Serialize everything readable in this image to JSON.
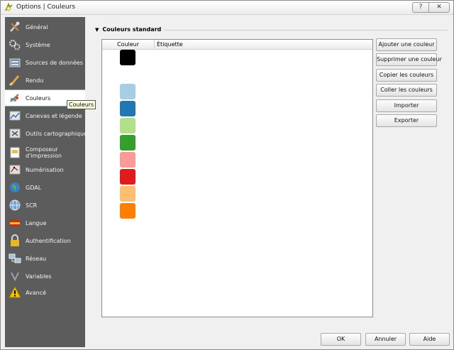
{
  "window": {
    "title": "Options | Couleurs"
  },
  "titlebar": {
    "help_label": "?",
    "close_label": "✕"
  },
  "sidebar": {
    "items": [
      {
        "label": "Général",
        "icon": "tools-icon"
      },
      {
        "label": "Système",
        "icon": "gears-icon"
      },
      {
        "label": "Sources de données",
        "icon": "datasource-icon"
      },
      {
        "label": "Rendu",
        "icon": "brush-icon"
      },
      {
        "label": "Couleurs",
        "icon": "palette-icon",
        "selected": true
      },
      {
        "label": "Canevas et légende",
        "icon": "canvas-icon"
      },
      {
        "label": "Outils cartographiques",
        "icon": "maptools-icon"
      },
      {
        "label": "Composeur d'impression",
        "icon": "composer-icon"
      },
      {
        "label": "Numérisation",
        "icon": "digitizing-icon"
      },
      {
        "label": "GDAL",
        "icon": "globe-icon"
      },
      {
        "label": "SCR",
        "icon": "crs-globe-icon"
      },
      {
        "label": "Langue",
        "icon": "flag-icon"
      },
      {
        "label": "Authentification",
        "icon": "lock-icon"
      },
      {
        "label": "Réseau",
        "icon": "network-icon"
      },
      {
        "label": "Variables",
        "icon": "variables-icon"
      },
      {
        "label": "Avancé",
        "icon": "warning-icon"
      }
    ]
  },
  "tooltip": {
    "text": "Couleurs"
  },
  "group": {
    "title": "Couleurs standard"
  },
  "table": {
    "headers": {
      "color": "Couleur",
      "label": "Étiquette"
    },
    "rows": [
      {
        "color": "#000000",
        "label": ""
      },
      {
        "color": "#a6cee3",
        "label": ""
      },
      {
        "color": "#1f78b4",
        "label": ""
      },
      {
        "color": "#b2df8a",
        "label": ""
      },
      {
        "color": "#33a02c",
        "label": ""
      },
      {
        "color": "#fb9a99",
        "label": ""
      },
      {
        "color": "#e31a1c",
        "label": ""
      },
      {
        "color": "#fdbf6f",
        "label": ""
      },
      {
        "color": "#ff7f00",
        "label": ""
      }
    ]
  },
  "buttons": {
    "add": "Ajouter une couleur",
    "remove": "Supprimer une couleur",
    "copy": "Copier les couleurs",
    "paste": "Coller les couleurs",
    "import": "Importer",
    "export": "Exporter"
  },
  "footer": {
    "ok": "OK",
    "cancel": "Annuler",
    "help": "Aide"
  }
}
